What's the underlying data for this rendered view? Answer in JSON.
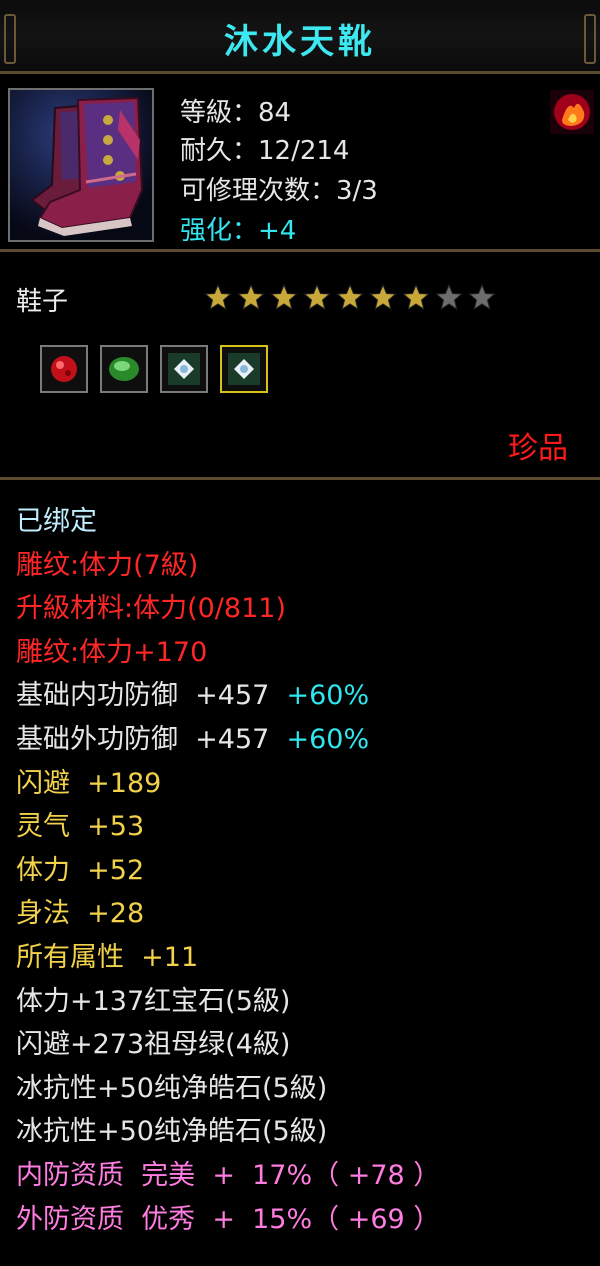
{
  "title": "沐水天靴",
  "header": {
    "level": "等級：84",
    "durability": "耐久：12/214",
    "repair_times": "可修理次数：3/3",
    "enhance": "强化：+4",
    "item_icon": "boots-icon",
    "badge_icon": "flame-badge-icon"
  },
  "item_type": "鞋子",
  "stars": {
    "total": 9,
    "filled": 7
  },
  "gems": [
    "red-gem-icon",
    "green-gem-icon",
    "white-gem-icon",
    "white-gem-icon"
  ],
  "rarity": "珍品",
  "attributes": {
    "bound": "已绑定",
    "carve_level": "雕纹:体力(7級)",
    "upgrade_material": "升級材料:体力(0/811)",
    "carve_bonus": "雕纹:体力+170",
    "inner_def": {
      "label": "基础内功防御  +457",
      "pct": "+60%"
    },
    "outer_def": {
      "label": "基础外功防御  +457",
      "pct": "+60%"
    },
    "dodge": "闪避  +189",
    "spirit": "灵气  +53",
    "stamina": "体力  +52",
    "agility": "身法  +28",
    "all_attr": "所有属性  +11",
    "gem1": "体力+137红宝石(5級)",
    "gem2": "闪避+273祖母绿(4級)",
    "gem3": "冰抗性+50纯净皓石(5級)",
    "gem4": "冰抗性+50纯净皓石(5級)",
    "quality_inner": "内防资质  完美  +  17%（ +78 ）",
    "quality_outer": "外防资质  优秀  +  15%（ +69 ）"
  },
  "colors": {
    "title": "#3de8f0",
    "enhance": "#33e5ee",
    "red": "#ff2626",
    "yellow": "#f2d24a",
    "pink": "#ff7ce0",
    "star_gold": "#c9a83a",
    "star_gray": "#6d6d6d"
  }
}
